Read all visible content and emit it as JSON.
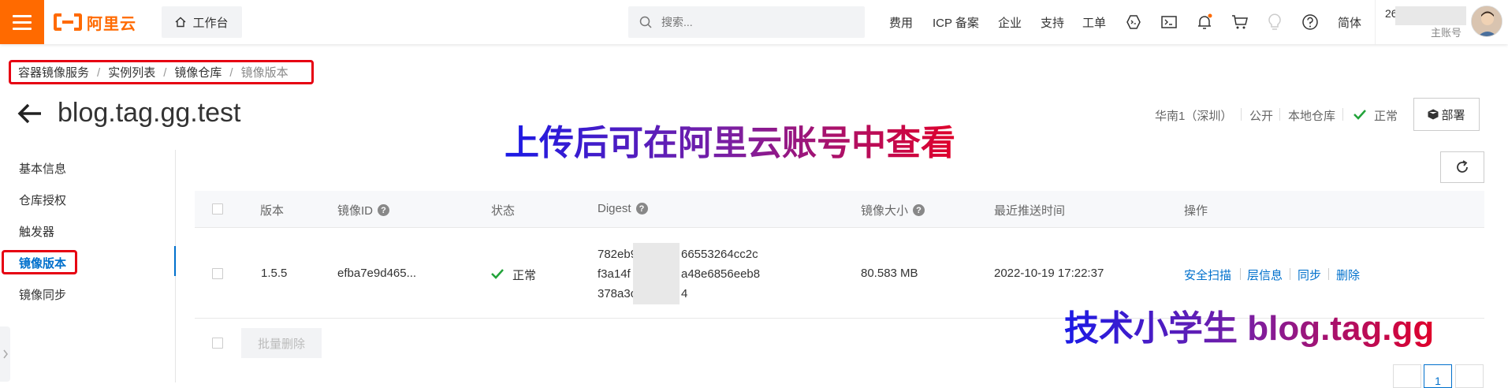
{
  "header": {
    "logo_text": "阿里云",
    "workbench_label": "工作台",
    "search_placeholder": "搜索...",
    "nav": [
      "费用",
      "ICP 备案",
      "企业",
      "支持",
      "工单"
    ],
    "lang_label": "简体",
    "account_id_prefix": "26",
    "account_type": "主账号",
    "icons": [
      "cloud-shell-icon",
      "terminal-icon",
      "bell-icon",
      "cart-icon",
      "lightbulb-icon",
      "help-icon"
    ],
    "accent_color": "#ff6a00"
  },
  "breadcrumb": [
    "容器镜像服务",
    "实例列表",
    "镜像仓库",
    "镜像版本"
  ],
  "page": {
    "title": "blog.tag.gg.test",
    "region": "华南1（深圳）",
    "visibility": "公开",
    "repo_type": "本地仓库",
    "status": "正常",
    "deploy_label": "部署"
  },
  "annotations": {
    "top": "上传后可在阿里云账号中查看",
    "bottom": "技术小学生 blog.tag.gg"
  },
  "sidebar": {
    "items": [
      {
        "label": "基本信息"
      },
      {
        "label": "仓库授权"
      },
      {
        "label": "触发器"
      },
      {
        "label": "镜像版本"
      },
      {
        "label": "镜像同步"
      }
    ],
    "active_index": 3
  },
  "table": {
    "columns": [
      "版本",
      "镜像ID",
      "状态",
      "Digest",
      "镜像大小",
      "最近推送时间",
      "操作"
    ],
    "rows": [
      {
        "version": "1.5.5",
        "image_id": "efba7e9d465...",
        "status": "正常",
        "digest_lines": [
          "782eb9",
          "66553264cc2c",
          "f3a14f",
          "a48e6856eeb8",
          "378a3c",
          "4"
        ],
        "size": "80.583 MB",
        "pushed_at": "2022-10-19 17:22:37",
        "actions": [
          "安全扫描",
          "层信息",
          "同步",
          "删除"
        ]
      }
    ],
    "batch_delete_label": "批量删除"
  },
  "pagination": {
    "current": "1"
  },
  "colors": {
    "link": "#0070cc",
    "success": "#22a33a",
    "highlight_border": "#e60012"
  }
}
